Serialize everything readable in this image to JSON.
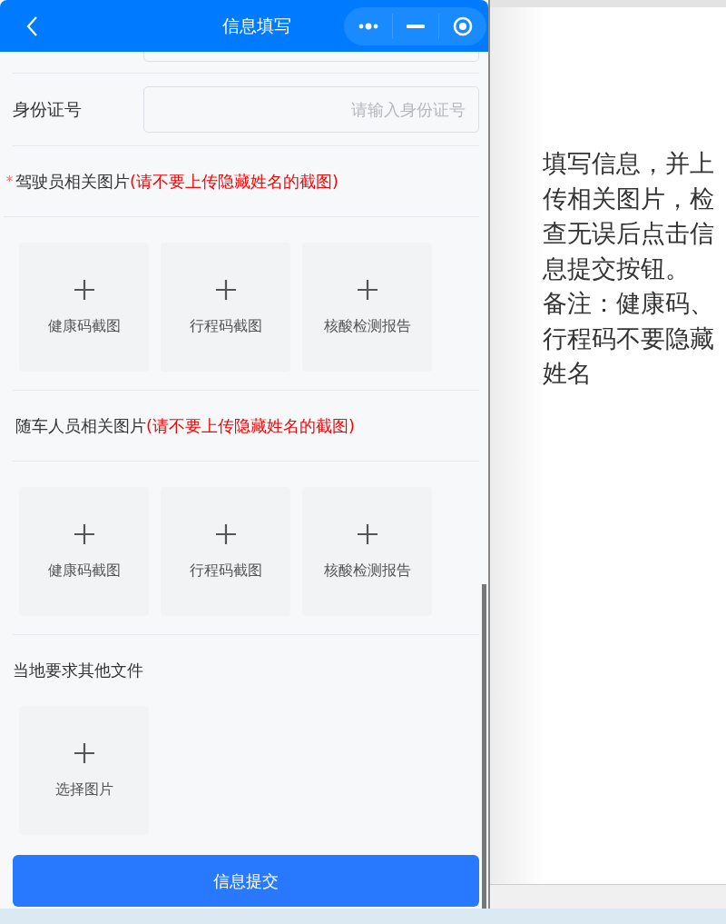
{
  "header": {
    "title": "信息填写"
  },
  "fields": [
    {
      "label": "身份证号",
      "placeholder": "请输入身份证号"
    }
  ],
  "sections": [
    {
      "required_mark": "*",
      "title": "驾驶员相关图片",
      "note": "(请不要上传隐藏姓名的截图)",
      "uploads": [
        "健康码截图",
        "行程码截图",
        "核酸检测报告"
      ]
    },
    {
      "title": "随车人员相关图片",
      "note": "(请不要上传隐藏姓名的截图)",
      "uploads": [
        "健康码截图",
        "行程码截图",
        "核酸检测报告"
      ]
    },
    {
      "title": "当地要求其他文件",
      "uploads": [
        "选择图片"
      ]
    }
  ],
  "submit": "信息提交",
  "instructions": [
    "填写信息，并上传相关图片，检查无误后点击信息提交按钮。",
    "备注：健康码、行程码不要隐藏姓名"
  ]
}
